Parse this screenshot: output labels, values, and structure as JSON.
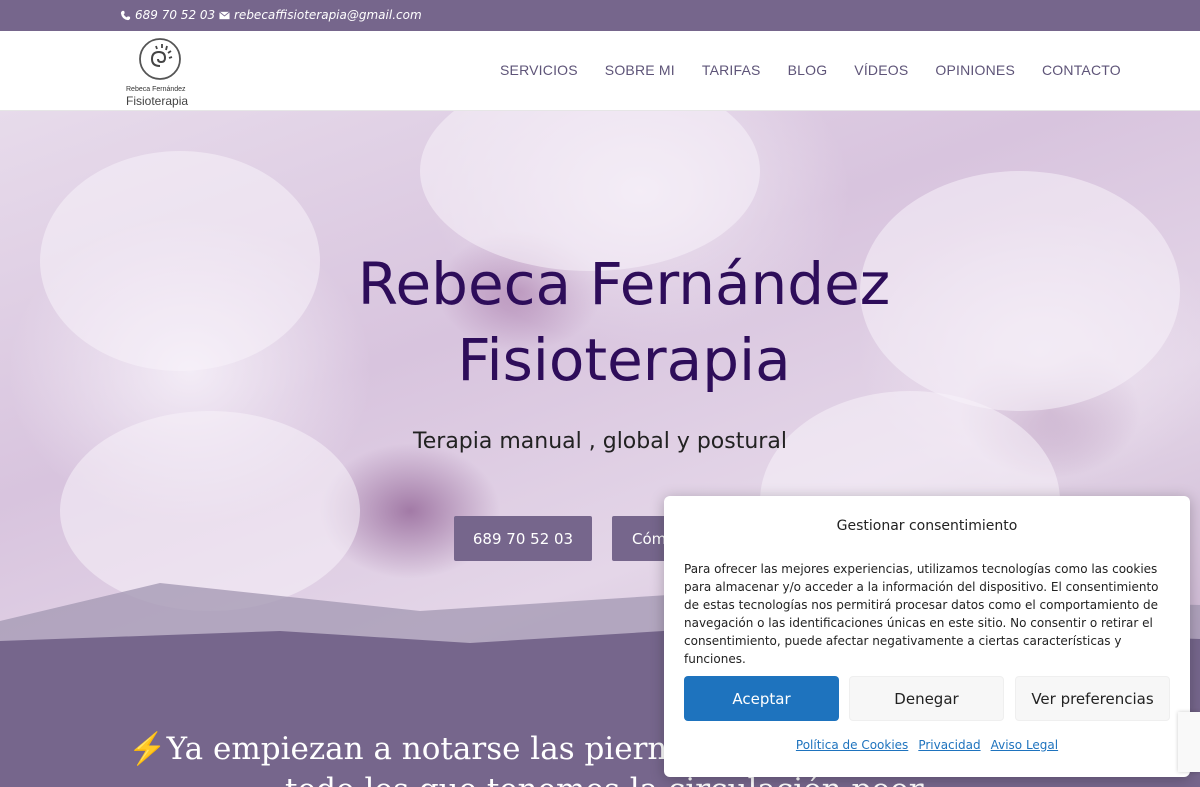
{
  "topbar": {
    "phone": "689 70 52 03",
    "email": "rebecaffisioterapia@gmail.com",
    "phone_icon": "phone-icon",
    "email_icon": "envelope-icon"
  },
  "logo": {
    "line1": "Rebeca Fernández",
    "line2": "Fisioterapia"
  },
  "nav": {
    "items": [
      "SERVICIOS",
      "SOBRE MI",
      "TARIFAS",
      "BLOG",
      "VÍDEOS",
      "OPINIONES",
      "CONTACTO"
    ]
  },
  "hero": {
    "title_line1": "Rebeca Fernández",
    "title_line2": "Fisioterapia",
    "subtitle": "Terapia manual , global y postural",
    "button1": "689 70 52 03",
    "button2": "Cóm"
  },
  "section": {
    "line1": "⚡Ya empiezan a notarse las pierna",
    "line2": "todo los que tenemos la circulación poor"
  },
  "consent": {
    "title": "Gestionar consentimiento",
    "text": "Para ofrecer las mejores experiencias, utilizamos tecnologías como las cookies para almacenar y/o acceder a la información del dispositivo. El consentimiento de estas tecnologías nos permitirá procesar datos como el comportamiento de navegación o las identificaciones únicas en este sitio. No consentir o retirar el consentimiento, puede afectar negativamente a ciertas características y funciones.",
    "accept": "Aceptar",
    "deny": "Denegar",
    "preferences": "Ver preferencias",
    "links": [
      "Política de Cookies",
      "Privacidad",
      "Aviso Legal"
    ]
  },
  "colors": {
    "brand_purple": "#76668c",
    "title_purple": "#2e0d5a",
    "accept_blue": "#1e73be"
  }
}
